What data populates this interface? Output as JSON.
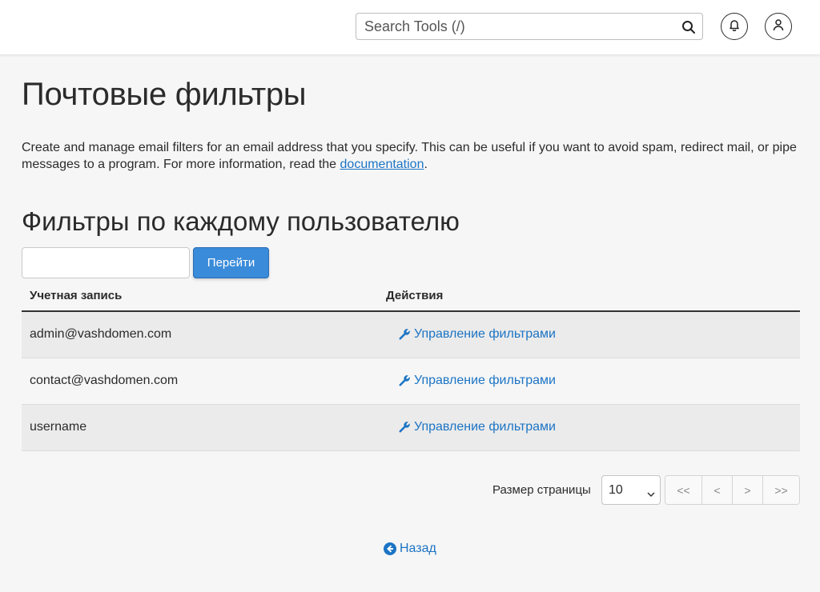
{
  "topbar": {
    "search_placeholder": "Search Tools (/)",
    "search_icon": "search-icon",
    "notifications_icon": "bell-icon",
    "user_icon": "user-icon"
  },
  "page": {
    "title": "Почтовые фильтры",
    "description_text": "Create and manage email filters for an email address that you specify. This can be useful if you want to avoid spam, redirect mail, or pipe messages to a program. For more information, read the ",
    "description_link": "documentation",
    "description_end": "."
  },
  "section": {
    "title": "Фильтры по каждому пользователю",
    "go_input_value": "",
    "go_button_label": "Перейти"
  },
  "table": {
    "headers": {
      "account": "Учетная запись",
      "actions": "Действия"
    },
    "rows": [
      {
        "account": "admin@vashdomen.com",
        "action": "Управление фильтрами"
      },
      {
        "account": "contact@vashdomen.com",
        "action": "Управление фильтрами"
      },
      {
        "account": "username",
        "action": "Управление фильтрами"
      }
    ]
  },
  "pagination": {
    "page_size_label": "Размер страницы",
    "page_size_value": "10",
    "first": "<<",
    "prev": "<",
    "next": ">",
    "last": ">>"
  },
  "footer": {
    "back_label": "Назад",
    "back_icon": "arrow-left-circle-icon"
  },
  "colors": {
    "link": "#1c74c4",
    "primary_button": "#3a8bd9",
    "background": "#f6f6f6"
  }
}
